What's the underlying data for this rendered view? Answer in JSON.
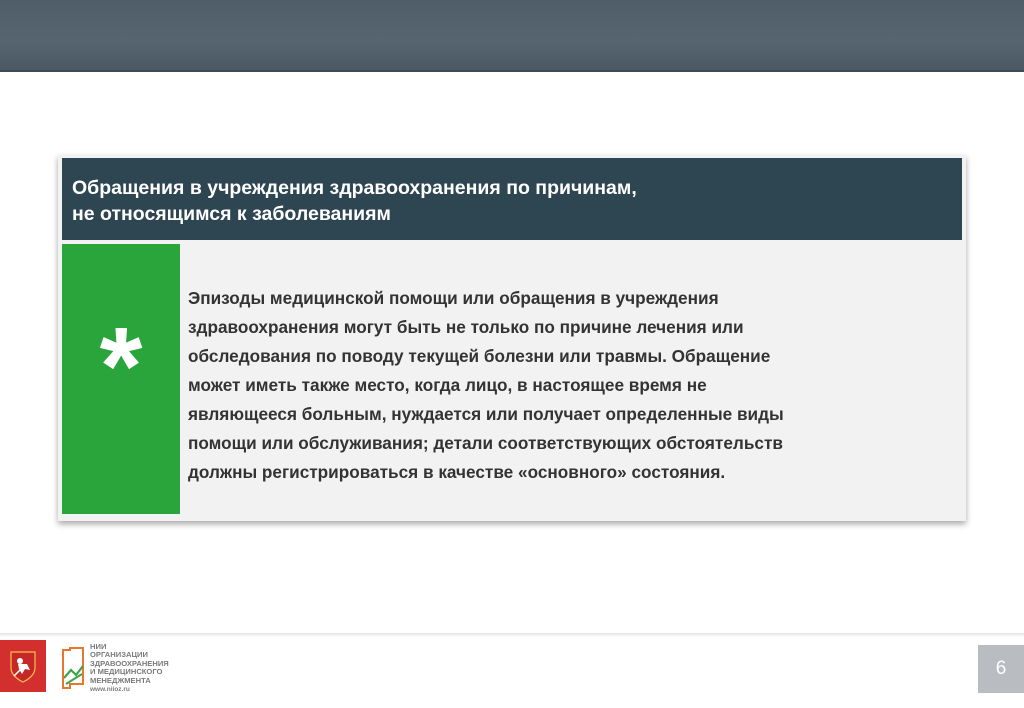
{
  "slide": {
    "title": "Обращения в учреждения здравоохранения по причинам,\nне относящимся к заболеваниям",
    "symbol": "*",
    "body": "Эпизоды медицинской помощи или обращения в учреждения\nздравоохранения могут быть не только по причине лечения или\nобследования по поводу текущей болезни или травмы. Обращение\nможет иметь также место, когда лицо, в настоящее время не\nявляющееся больным, нуждается или получает определенные виды\nпомощи или обслуживания; детали соответствующих обстоятельств\nдолжны регистрироваться в качестве «основного» состояния."
  },
  "footer": {
    "logo_text": "НИИ\nОРГАНИЗАЦИИ\nЗДРАВООХРАНЕНИЯ\nИ МЕДИЦИНСКОГО\nМЕНЕДЖМЕНТА",
    "logo_url": "www.niioz.ru",
    "page_number": "6"
  },
  "colors": {
    "top_bar": "#52616b",
    "header": "#2e4552",
    "accent_green": "#29a53c",
    "emblem_red": "#d32f2f",
    "page_badge": "#b9bcc0"
  },
  "icons": {
    "emblem": "moscow-coat-of-arms-icon",
    "logo": "niioz-logo-icon"
  }
}
